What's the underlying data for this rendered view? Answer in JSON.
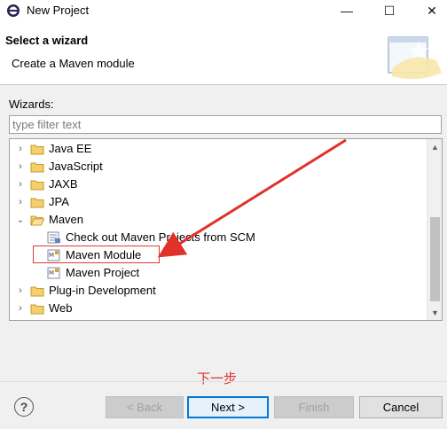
{
  "window": {
    "title": "New Project",
    "minimize_glyph": "—",
    "maximize_glyph": "☐",
    "close_glyph": "✕"
  },
  "header": {
    "title": "Select a wizard",
    "description": "Create a Maven module"
  },
  "wizards": {
    "label": "Wizards:",
    "filter_placeholder": "type filter text",
    "filter_value": ""
  },
  "tree": {
    "items": [
      {
        "label": "Java EE",
        "icon": "folder-icon",
        "expanded": false
      },
      {
        "label": "JavaScript",
        "icon": "folder-icon",
        "expanded": false
      },
      {
        "label": "JAXB",
        "icon": "folder-icon",
        "expanded": false
      },
      {
        "label": "JPA",
        "icon": "folder-icon",
        "expanded": false
      },
      {
        "label": "Maven",
        "icon": "folder-icon",
        "expanded": true
      },
      {
        "label": "Check out Maven Projects from SCM",
        "icon": "maven-scm-icon"
      },
      {
        "label": "Maven Module",
        "icon": "maven-module-icon",
        "highlighted": true
      },
      {
        "label": "Maven Project",
        "icon": "maven-project-icon"
      },
      {
        "label": "Plug-in Development",
        "icon": "folder-icon",
        "expanded": false
      },
      {
        "label": "Web",
        "icon": "folder-icon",
        "expanded": false
      }
    ]
  },
  "annotation": {
    "text": "下一步",
    "color": "#e0312b"
  },
  "buttons": {
    "help": "?",
    "back": "< Back",
    "next": "Next >",
    "finish": "Finish",
    "cancel": "Cancel"
  },
  "colors": {
    "accent": "#0078d7",
    "annotation_red": "#e0312b",
    "folder": "#e8b64c"
  }
}
